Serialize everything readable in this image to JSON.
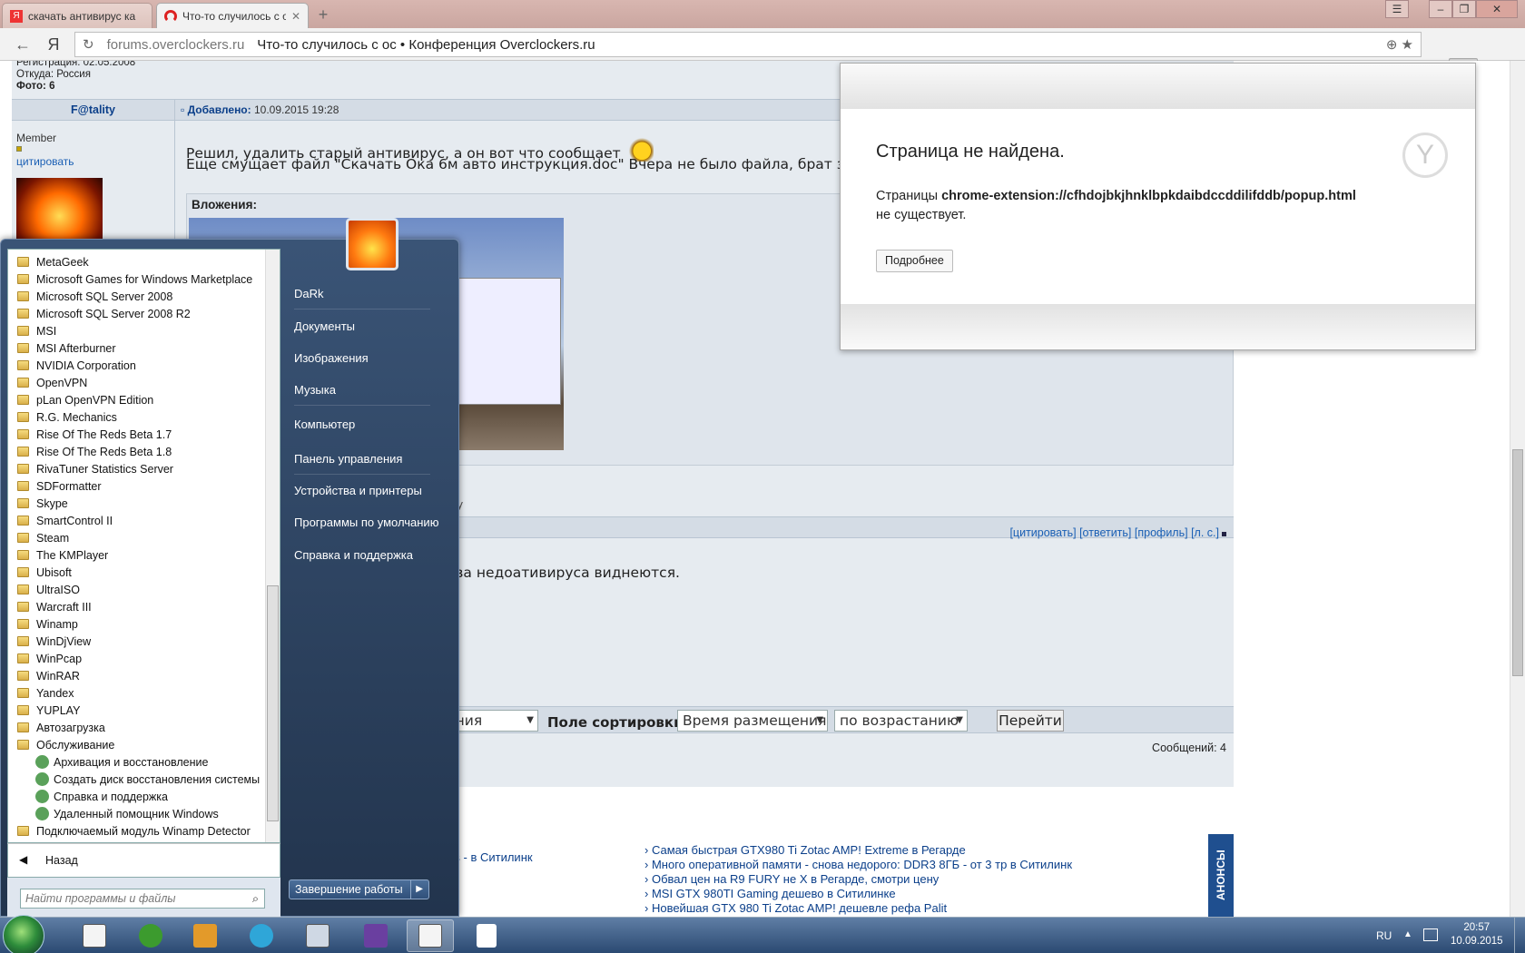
{
  "browser": {
    "tabs": [
      {
        "label": "скачать антивирус ка",
        "favicon": "yandex-icon",
        "active": false
      },
      {
        "label": "Что-то случилось с ос",
        "favicon": "overclockers-icon",
        "active": true
      }
    ],
    "new_tab": "+",
    "window_controls": [
      "☰",
      "–",
      "❐",
      "✕"
    ],
    "address": {
      "host": "forums.overclockers.ru",
      "title": "Что-то случилось с ос • Конференция Overclockers.ru"
    }
  },
  "forum": {
    "user_info": {
      "registered": "Регистрация: 02.05.2008",
      "from": "Откуда: Россия",
      "photo": "Фото: 6"
    },
    "post": {
      "author": "F@tality",
      "added_label": "Добавлено:",
      "added_date": "10.09.2015 19:28",
      "rank": "Member",
      "quote": "цитировать",
      "line1": "Решил, удалить старый антивирус, а он вот что сообщает",
      "line2": "Еще смущает файл \"Скачать Ока 6м авто инструкция.doc\" Вчера не было файла, брат закачал",
      "attachments": "Вложения:",
      "edited_tail": "ену"
    },
    "actions": [
      "[цитировать]",
      "[ответить]",
      "[профиль]",
      "[л. с.]"
    ],
    "reply_text": "астройку, там уже два недоативируса виднеются.",
    "filter": {
      "sel1": "ообщения",
      "sort_label": "Поле сортировки",
      "sel2": "Время размещения",
      "sel3": "по возрастанию",
      "go": "Перейти"
    },
    "message_count": "Сообщений: 4",
    "news_left": "в - в Ситилинк",
    "news": [
      "Самая быстрая GTX980 Ti Zotac AMP! Extreme в Регарде",
      "Много оперативной памяти - снова недорого: DDR3 8ГБ - от 3 тр в Ситилинк",
      "Обвал цен на R9 FURY не X в Регарде, смотри цену",
      "MSI GTX 980TI Gaming дешево в Ситилинке",
      "Новейшая GTX 980 Ti Zotac AMP! дешевле рефа Palit"
    ],
    "news_bar": "АНОНСЫ"
  },
  "popup": {
    "title": "Страница не найдена.",
    "msg_prefix": "Страницы ",
    "msg_url": "chrome-extension://cfhdojbkjhnklbpkdaibdccddilifddb/popup.html",
    "msg_suffix": "не существует.",
    "button": "Подробнее"
  },
  "start_menu": {
    "programs": [
      "MetaGeek",
      "Microsoft Games for Windows Marketplace",
      "Microsoft SQL Server 2008",
      "Microsoft SQL Server 2008 R2",
      "MSI",
      "MSI Afterburner",
      "NVIDIA Corporation",
      "OpenVPN",
      "pLan OpenVPN Edition",
      "R.G. Mechanics",
      "Rise Of The Reds Beta 1.7",
      "Rise Of The Reds Beta 1.8",
      "RivaTuner Statistics Server",
      "SDFormatter",
      "Skype",
      "SmartControl II",
      "Steam",
      "The KMPlayer",
      "Ubisoft",
      "UltraISO",
      "Warcraft III",
      "Winamp",
      "WinDjView",
      "WinPcap",
      "WinRAR",
      "Yandex",
      "YUPLAY",
      "Автозагрузка",
      "Обслуживание"
    ],
    "sub_items": [
      "Архивация и восстановление",
      "Создать диск восстановления системы",
      "Справка и поддержка",
      "Удаленный помощник Windows"
    ],
    "last_program": "Подключаемый модуль Winamp Detector",
    "back": "Назад",
    "search_placeholder": "Найти программы и файлы",
    "right_links": [
      "DaRk",
      "Документы",
      "Изображения",
      "Музыка",
      "Компьютер",
      "Панель управления",
      "Устройства и принтеры",
      "Программы по умолчанию",
      "Справка и поддержка"
    ],
    "shutdown": "Завершение работы"
  },
  "taskbar": {
    "apps": [
      "notepad-icon",
      "utorrent-icon",
      "media-player-icon",
      "itunes-icon",
      "calculator-icon",
      "visual-studio-icon",
      "notepad-active-icon",
      "document-icon"
    ],
    "lang": "RU",
    "time": "20:57",
    "date": "10.09.2015"
  }
}
